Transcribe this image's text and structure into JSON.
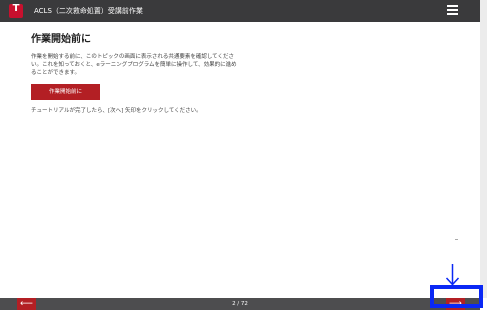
{
  "header": {
    "title": "ACLS（二次救命処置）受講前作業",
    "logo_icon": "aha-logo-icon",
    "menu_icon": "hamburger-menu-icon"
  },
  "main": {
    "heading": "作業開始前に",
    "intro": "作業を開始する前に、このトピックの画面に表示される共通要素を確認してください。これを知っておくと、eラーニングプログラムを簡単に操作して、効果的に進めることができます。",
    "start_button": "作業開始前に",
    "note": "チュートリアルが完了したら、[次へ] 矢印をクリックしてください。"
  },
  "footer": {
    "prev_icon": "arrow-left-icon",
    "next_icon": "arrow-right-icon",
    "prev_glyph": "⟵",
    "next_glyph": "⟶",
    "page_indicator": "2 / 72"
  },
  "overlay": {
    "highlight_color": "#0a28f5"
  },
  "colors": {
    "topbar": "#3a3a3c",
    "accent_red": "#b31f24",
    "bottombar": "#4d4d4f"
  }
}
